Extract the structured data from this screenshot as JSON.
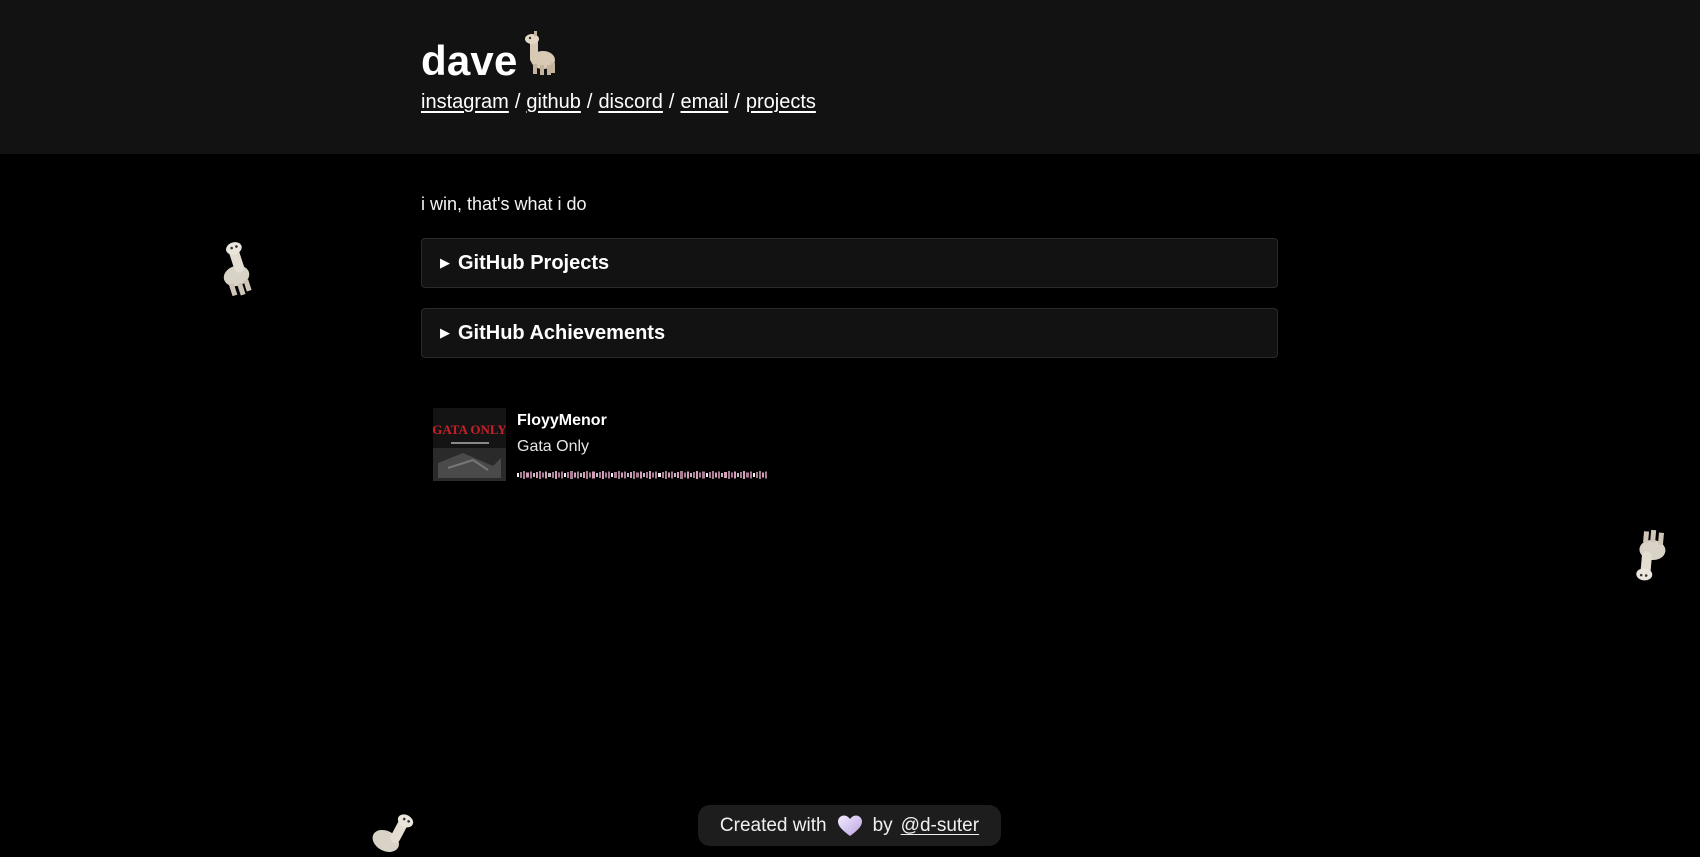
{
  "header": {
    "title": "dave",
    "title_icon": "llama-icon",
    "nav": [
      {
        "label": "instagram"
      },
      {
        "label": "github"
      },
      {
        "label": "discord"
      },
      {
        "label": "email"
      },
      {
        "label": "projects"
      }
    ],
    "separator": "/"
  },
  "main": {
    "tagline": "i win, that's what i do",
    "sections": [
      {
        "label": "GitHub Projects",
        "expanded": false
      },
      {
        "label": "GitHub Achievements",
        "expanded": false
      }
    ]
  },
  "now_playing": {
    "artist": "FloyyMenor",
    "track": "Gata Only",
    "album_art_text": "GATA ONLY",
    "accent_color": "#e0a8c6"
  },
  "footer": {
    "prefix": "Created with",
    "heart_icon": "heart-icon",
    "by": "by",
    "author": "@d-suter"
  },
  "colors": {
    "page_bg": "#000000",
    "header_bg": "#121212",
    "card_bg": "#121212"
  }
}
